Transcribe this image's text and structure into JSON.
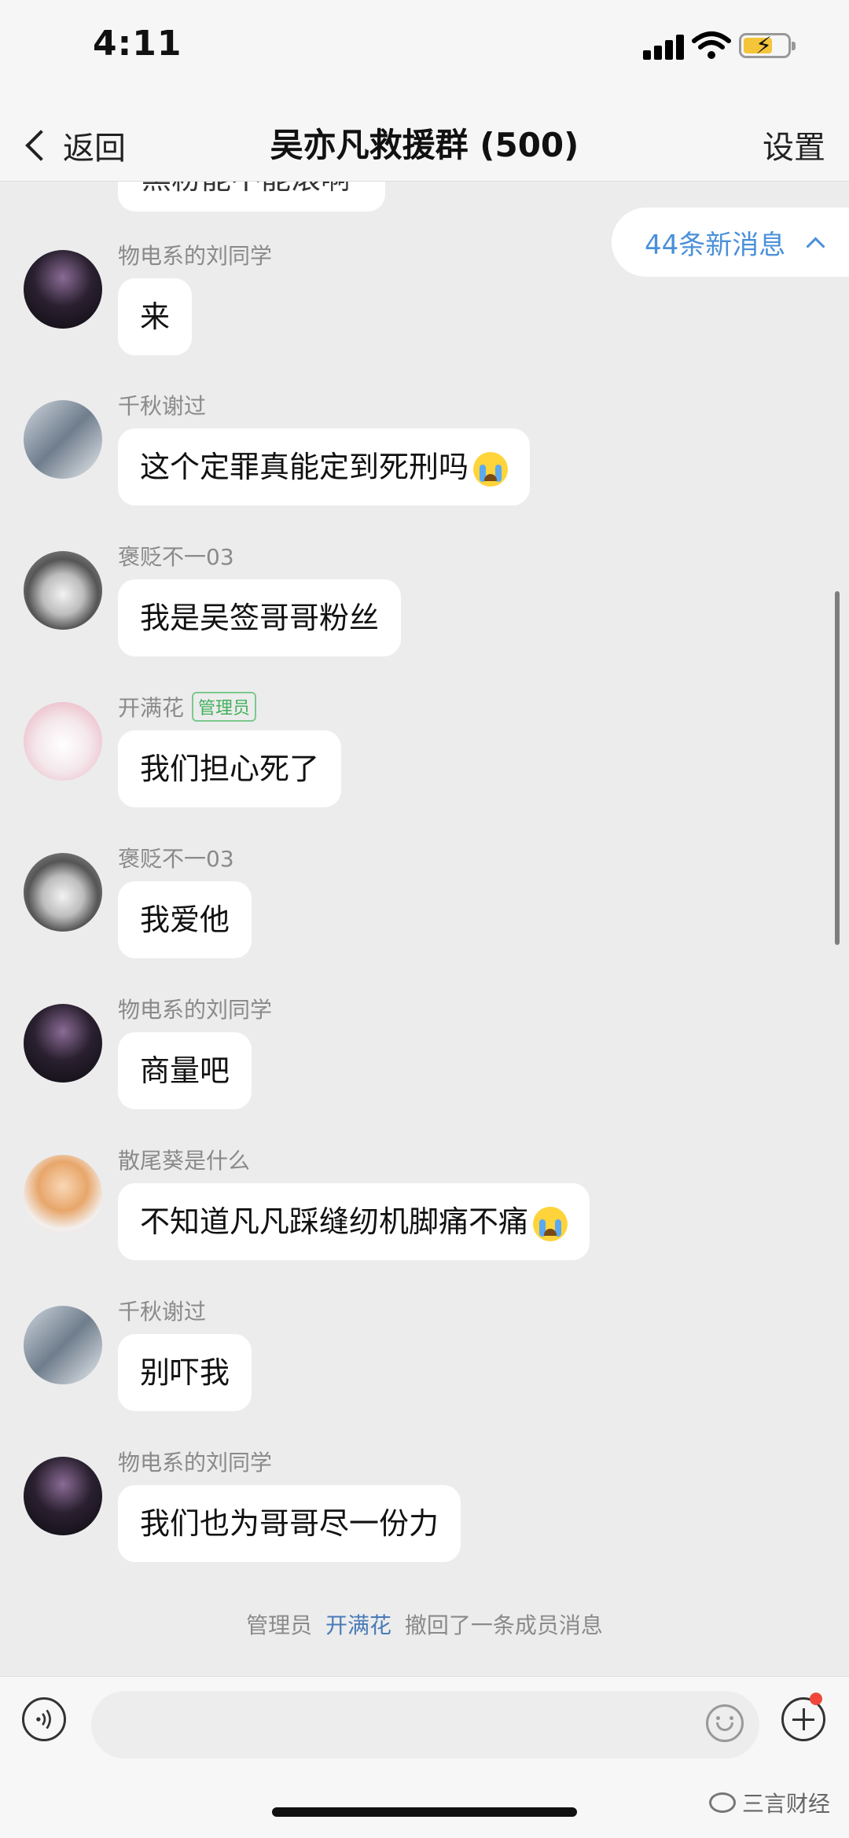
{
  "status": {
    "time": "4:11"
  },
  "nav": {
    "back_label": "返回",
    "title": "吴亦凡救援群 (500)",
    "settings_label": "设置"
  },
  "chat": {
    "partial_text": "黑粉能不能滚啊",
    "new_messages_label": "44条新消息",
    "messages": [
      {
        "sender": "物电系的刘同学",
        "text": "来"
      },
      {
        "sender": "千秋谢过",
        "text": "这个定罪真能定到死刑吗"
      },
      {
        "sender": "褒贬不一03",
        "text": "我是吴签哥哥粉丝"
      },
      {
        "sender": "开满花",
        "badge": "管理员",
        "text": "我们担心死了"
      },
      {
        "sender": "褒贬不一03",
        "text": "我爱他"
      },
      {
        "sender": "物电系的刘同学",
        "text": "商量吧"
      },
      {
        "sender": "散尾葵是什么",
        "text": "不知道凡凡踩缝纫机脚痛不痛"
      },
      {
        "sender": "千秋谢过",
        "text": "别吓我"
      },
      {
        "sender": "物电系的刘同学",
        "text": "我们也为哥哥尽一份力"
      }
    ],
    "system_note": {
      "prefix": "管理员",
      "name": "开满花",
      "suffix": "撤回了一条成员消息"
    }
  },
  "input": {
    "placeholder": ""
  },
  "watermark": "三言财经",
  "colors": {
    "accent": "#4a90d9",
    "badge_green": "#43b05c",
    "notify_red": "#f0473a"
  },
  "icons": [
    "back-chevron-icon",
    "signal-icon",
    "wifi-icon",
    "battery-icon",
    "voice-icon",
    "smile-icon",
    "plus-icon",
    "crying-emoji-icon"
  ]
}
